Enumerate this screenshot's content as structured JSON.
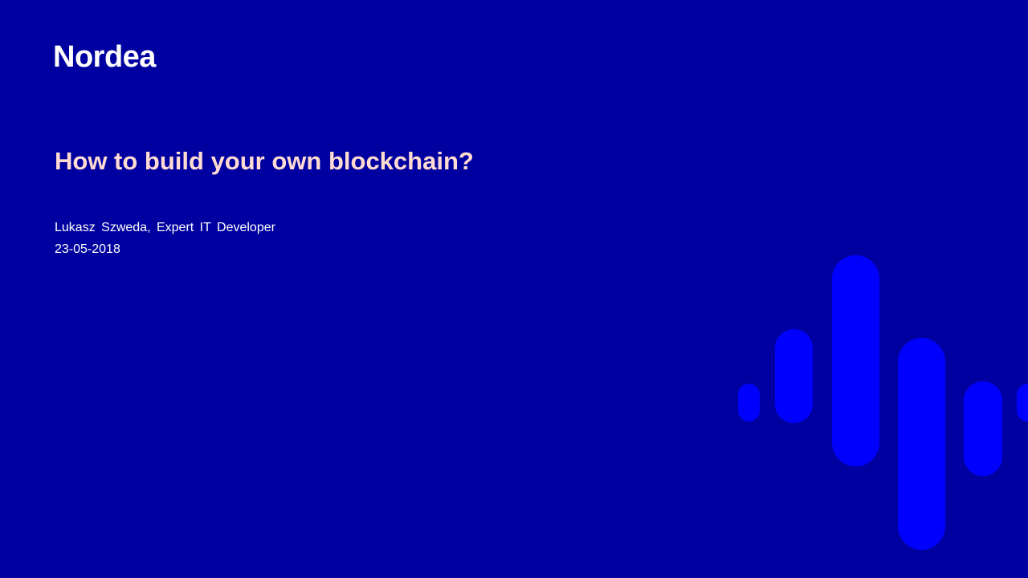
{
  "brand": {
    "logo_text": "Nordea"
  },
  "slide": {
    "title": "How to build your own blockchain?",
    "presenter": "Lukasz Szweda, Expert IT Developer",
    "date": "23-05-2018"
  },
  "colors": {
    "background": "#0000a0",
    "title": "#ffdbd2",
    "text": "#ffffff",
    "accent_bars": "#0000ff"
  }
}
